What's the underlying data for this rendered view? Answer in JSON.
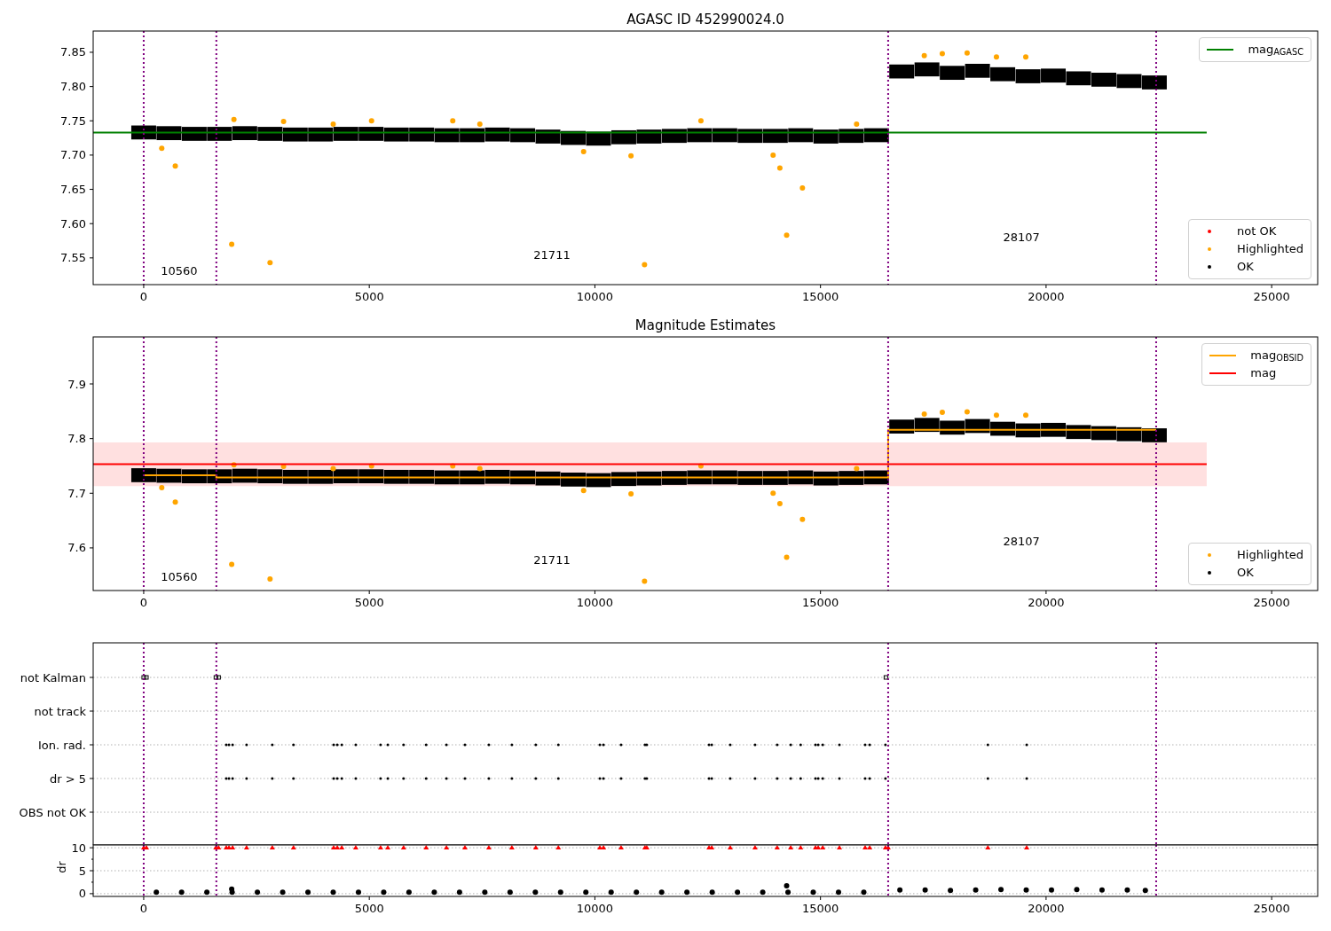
{
  "panels": [
    {
      "chart_data": {
        "type": "scatter",
        "title": "AGASC ID 452990024.0",
        "xlim": [
          -1120,
          26020
        ],
        "ylim": [
          7.511,
          7.881
        ],
        "xticks": [
          0,
          5000,
          10000,
          15000,
          20000,
          25000
        ],
        "yticks": [
          {
            "value": 7.55,
            "label": "7.55"
          },
          {
            "value": 7.6,
            "label": "7.60"
          },
          {
            "value": 7.65,
            "label": "7.65"
          },
          {
            "value": 7.7,
            "label": "7.70"
          },
          {
            "value": 7.75,
            "label": "7.75"
          },
          {
            "value": 7.8,
            "label": "7.80"
          },
          {
            "value": 7.85,
            "label": "7.85"
          }
        ],
        "series": [
          {
            "name": "mag$_{AGASC}$",
            "color": "#008000",
            "type": "line",
            "x": [
              -1120,
              23560
            ],
            "values": [
              7.733,
              7.733
            ]
          },
          {
            "name": "not OK",
            "color": "#ff0000",
            "marker": "circle"
          },
          {
            "name": "Highlighted",
            "color": "#ffa500",
            "marker": "circle",
            "x": [
              400,
              700,
              1950,
              2800,
              11100,
              14100,
              14250,
              14600,
              13950,
              10800,
              9750,
              7450,
              6850,
              5050,
              12350,
              17300,
              17700,
              18250,
              18900,
              19550,
              2000,
              3100,
              4200,
              15800
            ],
            "values": [
              7.71,
              7.684,
              7.57,
              7.543,
              7.54,
              7.681,
              7.583,
              7.652,
              7.7,
              7.699,
              7.705,
              7.745,
              7.75,
              7.75,
              7.75,
              7.845,
              7.848,
              7.849,
              7.843,
              7.843,
              7.752,
              7.749,
              7.745,
              7.745
            ]
          },
          {
            "name": "OK",
            "color": "#000000",
            "marker": "square",
            "x": [
              0,
              560,
              1120,
              1680,
              2240,
              2800,
              3360,
              3920,
              4480,
              5040,
              5600,
              6160,
              6720,
              7280,
              7840,
              8400,
              8960,
              9520,
              10080,
              10640,
              11200,
              11760,
              12320,
              12880,
              13440,
              14000,
              14560,
              15120,
              15680,
              16240,
              16800,
              17360,
              17920,
              18480,
              19040,
              19600,
              20160,
              20720,
              21280,
              21840,
              22400
            ],
            "values": [
              7.733,
              7.732,
              7.731,
              7.731,
              7.732,
              7.731,
              7.73,
              7.73,
              7.731,
              7.731,
              7.73,
              7.73,
              7.729,
              7.729,
              7.73,
              7.729,
              7.727,
              7.725,
              7.724,
              7.726,
              7.727,
              7.728,
              7.729,
              7.729,
              7.728,
              7.728,
              7.729,
              7.727,
              7.728,
              7.729,
              7.822,
              7.825,
              7.82,
              7.823,
              7.818,
              7.815,
              7.816,
              7.812,
              7.81,
              7.808,
              7.806
            ]
          }
        ],
        "ref_lines": [
          {
            "axis": "x",
            "value": 0,
            "color": "#800080"
          },
          {
            "axis": "x",
            "value": 1610,
            "color": "#800080"
          },
          {
            "axis": "x",
            "value": 16500,
            "color": "#800080"
          },
          {
            "axis": "x",
            "value": 22440,
            "color": "#800080"
          }
        ],
        "annotations": [
          "10560",
          "21711",
          "28107"
        ]
      }
    },
    {
      "chart_data": {
        "type": "scatter",
        "title": "Magnitude Estimates",
        "xlim": [
          -1120,
          26020
        ],
        "ylim": [
          7.522,
          7.986
        ],
        "xticks": [
          0,
          5000,
          10000,
          15000,
          20000,
          25000
        ],
        "yticks": [
          7.6,
          7.7,
          7.8,
          7.9
        ],
        "series": [
          {
            "name": "mag$_{OBSID}$",
            "color": "#ffa500",
            "type": "line",
            "x": [
              0,
              1610,
              1610,
              16500,
              16500,
              22440
            ],
            "values": [
              7.733,
              7.733,
              7.729,
              7.729,
              7.816,
              7.816
            ]
          },
          {
            "name": "mag",
            "color": "#ff0000",
            "type": "line",
            "x": [
              -1120,
              23560
            ],
            "values": [
              7.753,
              7.753
            ]
          },
          {
            "name": "Highlighted",
            "color": "#ffa500",
            "marker": "circle",
            "x": [
              400,
              700,
              1950,
              2800,
              11100,
              14100,
              14250,
              14600,
              13950,
              10800,
              9750,
              7450,
              6850,
              5050,
              12350,
              17300,
              17700,
              18250,
              18900,
              19550,
              2000,
              3100,
              4200,
              15800
            ],
            "values": [
              7.71,
              7.684,
              7.57,
              7.543,
              7.539,
              7.681,
              7.583,
              7.652,
              7.7,
              7.699,
              7.705,
              7.745,
              7.75,
              7.75,
              7.75,
              7.845,
              7.848,
              7.849,
              7.843,
              7.843,
              7.752,
              7.749,
              7.745,
              7.745
            ]
          },
          {
            "name": "OK",
            "color": "#000000",
            "marker": "square",
            "x": [
              0,
              560,
              1120,
              1680,
              2240,
              2800,
              3360,
              3920,
              4480,
              5040,
              5600,
              6160,
              6720,
              7280,
              7840,
              8400,
              8960,
              9520,
              10080,
              10640,
              11200,
              11760,
              12320,
              12880,
              13440,
              14000,
              14560,
              15120,
              15680,
              16240,
              16800,
              17360,
              17920,
              18480,
              19040,
              19600,
              20160,
              20720,
              21280,
              21840,
              22400
            ],
            "values": [
              7.733,
              7.732,
              7.731,
              7.731,
              7.732,
              7.731,
              7.73,
              7.73,
              7.731,
              7.731,
              7.73,
              7.73,
              7.729,
              7.729,
              7.73,
              7.729,
              7.727,
              7.725,
              7.724,
              7.726,
              7.727,
              7.728,
              7.729,
              7.729,
              7.728,
              7.728,
              7.729,
              7.727,
              7.728,
              7.729,
              7.822,
              7.825,
              7.82,
              7.823,
              7.818,
              7.815,
              7.816,
              7.812,
              7.81,
              7.808,
              7.806
            ]
          }
        ],
        "bands": [
          {
            "axis": "y",
            "from": 7.713,
            "to": 7.793,
            "color": "#ffe0e0"
          }
        ],
        "ref_lines": [
          {
            "axis": "x",
            "value": 0,
            "color": "#800080"
          },
          {
            "axis": "x",
            "value": 1610,
            "color": "#800080"
          },
          {
            "axis": "x",
            "value": 16500,
            "color": "#800080"
          },
          {
            "axis": "x",
            "value": 22440,
            "color": "#800080"
          }
        ],
        "annotations": [
          "10560",
          "21711",
          "28107"
        ]
      }
    }
  ],
  "flags": {
    "rows": [
      "not Kalman",
      "not track",
      "Ion. rad.",
      "dr > 5",
      "OBS not OK"
    ]
  },
  "dr": {
    "chart_data": {
      "type": "scatter",
      "grid": true,
      "ylabel": "dr",
      "xlim": [
        -1120,
        26020
      ],
      "ylim": [
        -0.6,
        10.6
      ],
      "xticks": [
        0,
        5000,
        10000,
        15000,
        20000,
        25000
      ],
      "yticks": [
        0,
        5,
        10
      ],
      "series": [
        {
          "color": "#000000",
          "marker": "circle",
          "x": [
            280,
            840,
            1400,
            1960,
            2520,
            3080,
            3640,
            4200,
            4760,
            5320,
            5880,
            6440,
            7000,
            7560,
            8120,
            8680,
            9240,
            9800,
            10360,
            10920,
            11480,
            12040,
            12600,
            13160,
            13720,
            14280,
            14840,
            15400,
            15960,
            16760,
            17320,
            17880,
            18440,
            19000,
            19560,
            20120,
            20680,
            21240,
            21800,
            22200
          ],
          "values": [
            0.3,
            0.3,
            0.3,
            0.3,
            0.3,
            0.3,
            0.3,
            0.3,
            0.3,
            0.3,
            0.3,
            0.3,
            0.3,
            0.3,
            0.3,
            0.3,
            0.3,
            0.3,
            0.3,
            0.3,
            0.3,
            0.3,
            0.3,
            0.3,
            0.3,
            0.3,
            0.3,
            0.3,
            0.3,
            0.8,
            0.8,
            0.7,
            0.8,
            0.9,
            0.8,
            0.8,
            0.9,
            0.8,
            0.8,
            0.7
          ]
        },
        {
          "color": "#000000",
          "marker": "circle",
          "x": [
            1950,
            14250
          ],
          "values": [
            1.0,
            1.7
          ]
        },
        {
          "color": "#ff0000",
          "marker": "triangle",
          "x": [
            0,
            60,
            1600,
            1660,
            1830,
            1890,
            1970,
            2280,
            2850,
            3320,
            4210,
            4290,
            4390,
            4700,
            5250,
            5410,
            5760,
            6260,
            6710,
            7120,
            7650,
            8160,
            8690,
            9190,
            10110,
            10190,
            10580,
            11110,
            11150,
            12530,
            12590,
            13000,
            13550,
            14040,
            14340,
            14560,
            14890,
            14950,
            15050,
            15420,
            15990,
            16090,
            16440,
            16500,
            18710,
            19570
          ],
          "values": [
            10,
            10,
            10,
            10,
            10,
            10,
            10,
            10,
            10,
            10,
            10,
            10,
            10,
            10,
            10,
            10,
            10,
            10,
            10,
            10,
            10,
            10,
            10,
            10,
            10,
            10,
            10,
            10,
            10,
            10,
            10,
            10,
            10,
            10,
            10,
            10,
            10,
            10,
            10,
            10,
            10,
            10,
            10,
            10,
            10,
            10
          ]
        }
      ],
      "ref_lines": [
        {
          "axis": "x",
          "value": 0,
          "color": "#800080"
        },
        {
          "axis": "x",
          "value": 1610,
          "color": "#800080"
        },
        {
          "axis": "x",
          "value": 16500,
          "color": "#800080"
        },
        {
          "axis": "x",
          "value": 22440,
          "color": "#800080"
        }
      ]
    }
  }
}
